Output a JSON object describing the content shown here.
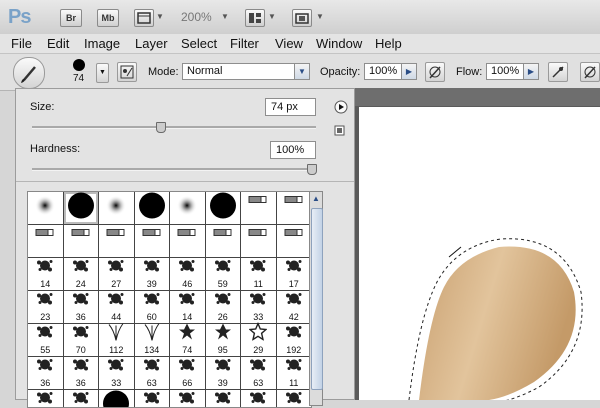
{
  "appbar": {
    "logo": "Ps",
    "bridge_label": "Br",
    "minibridge_label": "Mb",
    "zoom": "200%"
  },
  "menu": [
    "File",
    "Edit",
    "Image",
    "Layer",
    "Select",
    "Filter",
    "View",
    "Window",
    "Help"
  ],
  "options": {
    "brush_size": "74",
    "mode_label": "Mode:",
    "mode_value": "Normal",
    "opacity_label": "Opacity:",
    "opacity_value": "100%",
    "flow_label": "Flow:",
    "flow_value": "100%"
  },
  "brush_panel": {
    "size_label": "Size:",
    "size_value": "74 px",
    "size_level": 0.45,
    "hardness_label": "Hardness:",
    "hardness_value": "100%",
    "hardness_level": 1.0,
    "presets": [
      {
        "kind": "soft",
        "label": ""
      },
      {
        "kind": "hard",
        "label": ""
      },
      {
        "kind": "soft",
        "label": ""
      },
      {
        "kind": "hard",
        "label": ""
      },
      {
        "kind": "soft",
        "label": ""
      },
      {
        "kind": "hard",
        "label": ""
      },
      {
        "kind": "tip",
        "label": ""
      },
      {
        "kind": "tip",
        "label": ""
      },
      {
        "kind": "tip",
        "label": ""
      },
      {
        "kind": "tip",
        "label": ""
      },
      {
        "kind": "tip",
        "label": ""
      },
      {
        "kind": "tip",
        "label": ""
      },
      {
        "kind": "tip",
        "label": ""
      },
      {
        "kind": "tip",
        "label": ""
      },
      {
        "kind": "tip",
        "label": ""
      },
      {
        "kind": "tip",
        "label": ""
      },
      {
        "kind": "splat",
        "label": "14"
      },
      {
        "kind": "splat",
        "label": "24"
      },
      {
        "kind": "splat",
        "label": "27"
      },
      {
        "kind": "splat",
        "label": "39"
      },
      {
        "kind": "splat",
        "label": "46"
      },
      {
        "kind": "splat",
        "label": "59"
      },
      {
        "kind": "splat",
        "label": "11"
      },
      {
        "kind": "splat",
        "label": "17"
      },
      {
        "kind": "splat",
        "label": "23"
      },
      {
        "kind": "splat",
        "label": "36"
      },
      {
        "kind": "splat",
        "label": "44"
      },
      {
        "kind": "splat",
        "label": "60"
      },
      {
        "kind": "splat",
        "label": "14"
      },
      {
        "kind": "splat",
        "label": "26"
      },
      {
        "kind": "splat",
        "label": "33"
      },
      {
        "kind": "splat",
        "label": "42"
      },
      {
        "kind": "splat",
        "label": "55"
      },
      {
        "kind": "splat",
        "label": "70"
      },
      {
        "kind": "grass",
        "label": "112"
      },
      {
        "kind": "grass",
        "label": "134"
      },
      {
        "kind": "leaf",
        "label": "74"
      },
      {
        "kind": "leaf",
        "label": "95"
      },
      {
        "kind": "star",
        "label": "29"
      },
      {
        "kind": "splat",
        "label": "192"
      },
      {
        "kind": "splat",
        "label": "36"
      },
      {
        "kind": "splat",
        "label": "36"
      },
      {
        "kind": "splat",
        "label": "33"
      },
      {
        "kind": "splat",
        "label": "63"
      },
      {
        "kind": "splat",
        "label": "66"
      },
      {
        "kind": "splat",
        "label": "39"
      },
      {
        "kind": "splat",
        "label": "63"
      },
      {
        "kind": "splat",
        "label": "11"
      },
      {
        "kind": "splat",
        "label": ""
      },
      {
        "kind": "splat",
        "label": ""
      },
      {
        "kind": "hard",
        "label": ""
      },
      {
        "kind": "splat",
        "label": ""
      },
      {
        "kind": "splat",
        "label": ""
      },
      {
        "kind": "splat",
        "label": ""
      },
      {
        "kind": "splat",
        "label": ""
      },
      {
        "kind": "splat",
        "label": ""
      }
    ]
  },
  "colors": {
    "wood": "#d1a878",
    "accent": "#2a4d86"
  }
}
